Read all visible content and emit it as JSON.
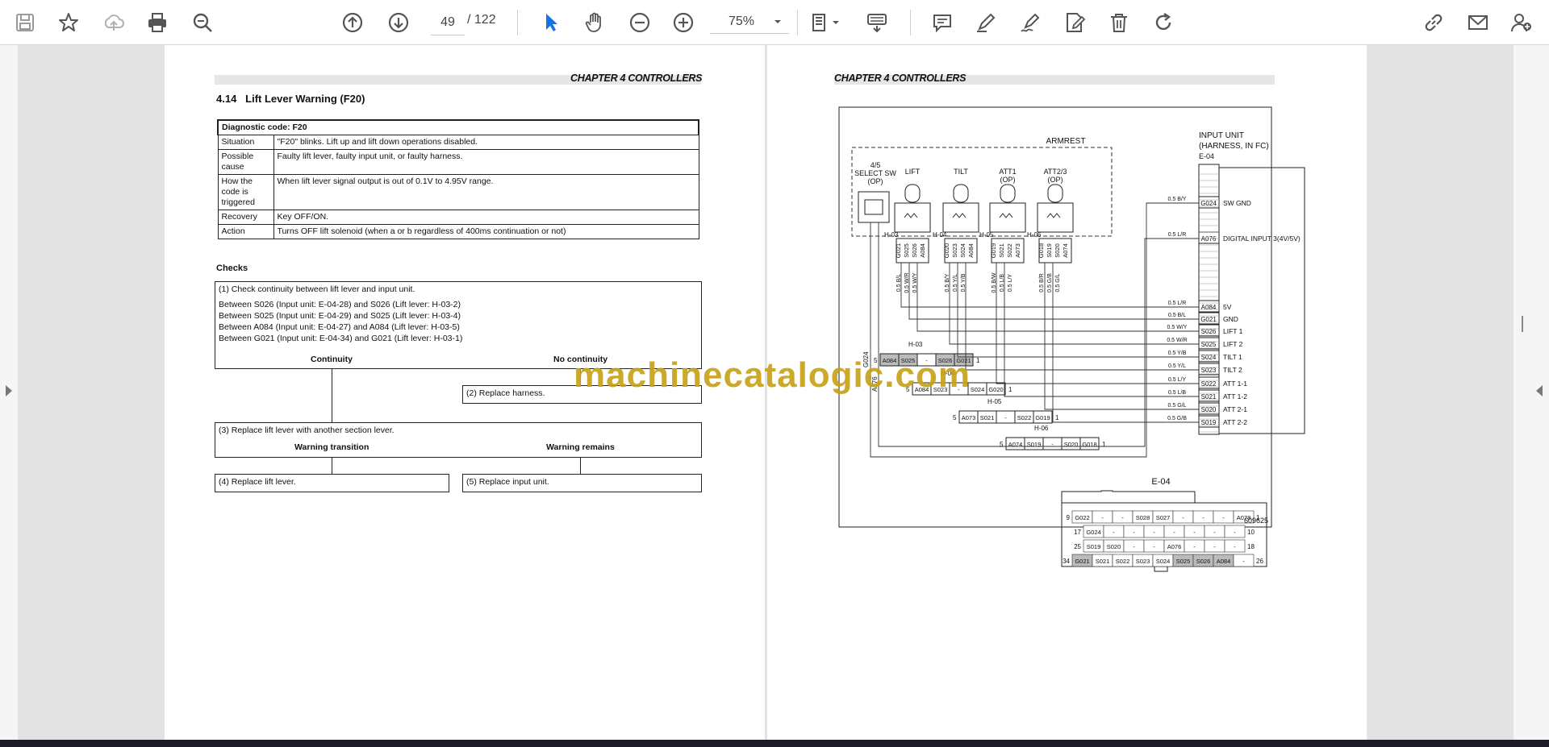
{
  "toolbar": {
    "page_current": "49",
    "page_total": "/  122",
    "zoom": "75%",
    "icons": [
      "save-icon",
      "star-icon",
      "upload-icon",
      "print-icon",
      "zoom-search-icon",
      "page-up-icon",
      "page-down-icon",
      "select-cursor-icon",
      "hand-icon",
      "zoom-out-icon",
      "zoom-in-icon",
      "fit-page-icon",
      "read-mode-icon",
      "comment-icon",
      "highlight-icon",
      "sign-icon",
      "edit-pdf-icon",
      "delete-icon",
      "rotate-icon",
      "share-link-icon",
      "email-icon",
      "add-user-icon"
    ],
    "accent": "#1473e6"
  },
  "left_page": {
    "header": "CHAPTER 4 CONTROLLERS",
    "section_number": "4.14",
    "section_title": "Lift Lever Warning (F20)",
    "diag_code": "Diagnostic code: F20",
    "rows": [
      {
        "label": "Situation",
        "value": "\"F20\" blinks. Lift up and lift down operations disabled."
      },
      {
        "label": "Possible cause",
        "value": "Faulty lift lever, faulty input unit, or faulty harness."
      },
      {
        "label": "How the code is triggered",
        "value": "When lift lever signal output is out of 0.1V to 4.95V range."
      },
      {
        "label": "Recovery",
        "value": "Key OFF/ON."
      },
      {
        "label": "Action",
        "value": "Turns OFF lift solenoid (when a or b regardless of 400ms continuation or not)"
      }
    ],
    "checks_label": "Checks",
    "step1_title": "(1) Check continuity between lift lever and input unit.",
    "step1_lines": [
      "Between S026 (Input unit: E-04-28) and S026 (Lift lever: H-03-2)",
      "Between S025 (Input unit: E-04-29) and S025 (Lift lever: H-03-4)",
      "Between A084 (Input unit: E-04-27) and A084 (Lift lever: H-03-5)",
      "Between G021 (Input unit: E-04-34) and G021 (Lift lever: H-03-1)"
    ],
    "continuity": "Continuity",
    "no_continuity": "No continuity",
    "step2": "(2) Replace harness.",
    "step3": "(3) Replace lift lever with another section lever.",
    "warning_transition": "Warning transition",
    "warning_remains": "Warning remains",
    "step4": "(4) Replace lift lever.",
    "step5": "(5) Replace input unit."
  },
  "right_page": {
    "header": "CHAPTER 4 CONTROLLERS",
    "armrest": "ARMREST",
    "select_sw": [
      "4/5",
      "SELECT SW",
      "(OP)"
    ],
    "levers": [
      "LIFT",
      "TILT",
      "ATT1",
      "ATT2/3"
    ],
    "lever_sub": [
      "",
      "",
      "(OP)",
      "(OP)"
    ],
    "input_unit": [
      "INPUT UNIT",
      "(HARNESS, IN FC)",
      "E-04"
    ],
    "pins": [
      {
        "code": "G024",
        "wire": "0.5 B/Y",
        "fn": "SW GND"
      },
      {
        "code": "A076",
        "wire": "0.5 L/R",
        "fn": "DIGITAL INPUT 3(4V/5V)"
      },
      {
        "code": "A084",
        "wire": "0.5 L/R",
        "fn": "5V"
      },
      {
        "code": "G021",
        "wire": "0.5 B/L",
        "fn": "GND"
      },
      {
        "code": "S026",
        "wire": "0.5 W/Y",
        "fn": "LIFT 1"
      },
      {
        "code": "S025",
        "wire": "0.5 W/R",
        "fn": "LIFT 2"
      },
      {
        "code": "S024",
        "wire": "0.5 Y/B",
        "fn": "TILT 1"
      },
      {
        "code": "S023",
        "wire": "0.5 Y/L",
        "fn": "TILT 2"
      },
      {
        "code": "S022",
        "wire": "0.5 L/Y",
        "fn": "ATT 1-1"
      },
      {
        "code": "S021",
        "wire": "0.5 L/B",
        "fn": "ATT 1-2"
      },
      {
        "code": "S020",
        "wire": "0.5 G/L",
        "fn": "ATT 2-1"
      },
      {
        "code": "S019",
        "wire": "0.5 G/B",
        "fn": "ATT 2-2"
      }
    ],
    "h03": {
      "label": "H-03",
      "cells": [
        "A084",
        "S025",
        "-",
        "S026",
        "G021"
      ],
      "left": "5",
      "right": "1"
    },
    "h04": {
      "label": "H-04",
      "cells": [
        "A084",
        "S023",
        "-",
        "S024",
        "G020"
      ],
      "left": "5",
      "right": "1"
    },
    "h05": {
      "label": "H-05",
      "cells": [
        "A073",
        "S021",
        "-",
        "S022",
        "G019"
      ],
      "left": "5",
      "right": "1"
    },
    "h06": {
      "label": "H-06",
      "cells": [
        "A074",
        "S019",
        "-",
        "S020",
        "G018"
      ],
      "left": "5",
      "right": "1"
    },
    "lever_conn_labels": [
      "H-03",
      "H-04",
      "H-05",
      "H-06"
    ],
    "lever_pins": [
      [
        "G021",
        "S025",
        "S026",
        "A084"
      ],
      [
        "G020",
        "S023",
        "S024",
        "A084"
      ],
      [
        "G019",
        "S021",
        "S022",
        "A073"
      ],
      [
        "G018",
        "S019",
        "S020",
        "A074"
      ]
    ],
    "lever_wires": [
      [
        "0.5 B/L",
        "0.5 W/R",
        "0.5 W/Y"
      ],
      [
        "0.5 B/Y",
        "0.5 Y/L",
        "0.5 Y/B"
      ],
      [
        "0.5 B/W",
        "0.5 L/B",
        "0.5 L/Y"
      ],
      [
        "0.5 B/R",
        "0.5 G/B",
        "0.5 G/L"
      ]
    ],
    "sw_wires": [
      "G024",
      "A076"
    ],
    "e04_title": "E-04",
    "e04_rows": [
      {
        "start": "9",
        "cells": [
          "G022",
          "-",
          "-",
          "S028",
          "S027",
          "-",
          "-",
          "-",
          "A078"
        ],
        "end": "1"
      },
      {
        "start": "17",
        "cells": [
          "G024",
          "-",
          "-",
          "-",
          "-",
          "-",
          "-",
          "-"
        ],
        "end": "10"
      },
      {
        "start": "25",
        "cells": [
          "S019",
          "S020",
          "-",
          "-",
          "A076",
          "-",
          "-",
          "-"
        ],
        "end": "18"
      },
      {
        "start": "34",
        "cells": [
          "G021",
          "S021",
          "S022",
          "S023",
          "S024",
          "S025",
          "S026",
          "A084",
          "-"
        ],
        "end": "26"
      }
    ],
    "figure_id": "609625"
  },
  "watermark": "machinecatalogic.com"
}
